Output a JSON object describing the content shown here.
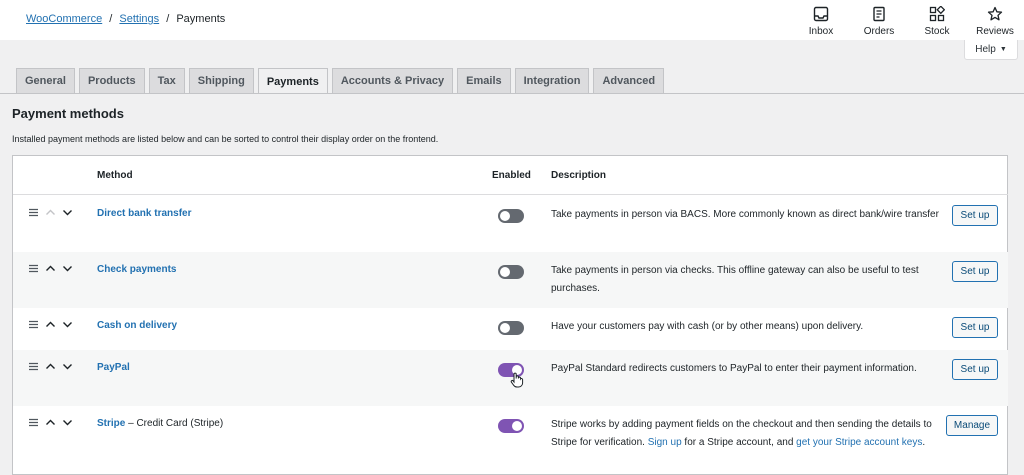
{
  "breadcrumb": {
    "root": "WooCommerce",
    "sep": "/",
    "middle": "Settings",
    "current": "Payments"
  },
  "toolbar": {
    "items": [
      {
        "label": "Inbox",
        "icon": "inbox-icon"
      },
      {
        "label": "Orders",
        "icon": "orders-icon"
      },
      {
        "label": "Stock",
        "icon": "stock-icon"
      },
      {
        "label": "Reviews",
        "icon": "star-icon"
      }
    ]
  },
  "help": {
    "label": "Help",
    "caret": "▼"
  },
  "tabs": [
    "General",
    "Products",
    "Tax",
    "Shipping",
    "Payments",
    "Accounts & Privacy",
    "Emails",
    "Integration",
    "Advanced"
  ],
  "active_tab": "Payments",
  "section": {
    "title": "Payment methods",
    "description": "Installed payment methods are listed below and can be sorted to control their display order on the frontend."
  },
  "table": {
    "headers": {
      "method": "Method",
      "enabled": "Enabled",
      "description": "Description"
    },
    "rows": [
      {
        "name": "Direct bank transfer",
        "suffix": "",
        "enabled": false,
        "description": "Take payments in person via BACS. More commonly known as direct bank/wire transfer",
        "desc_link1": "",
        "desc_mid": "",
        "desc_link2": "",
        "desc_end": "",
        "action": "Set up"
      },
      {
        "name": "Check payments",
        "suffix": "",
        "enabled": false,
        "description": "Take payments in person via checks. This offline gateway can also be useful to test purchases.",
        "desc_link1": "",
        "desc_mid": "",
        "desc_link2": "",
        "desc_end": "",
        "action": "Set up"
      },
      {
        "name": "Cash on delivery",
        "suffix": "",
        "enabled": false,
        "description": "Have your customers pay with cash (or by other means) upon delivery.",
        "desc_link1": "",
        "desc_mid": "",
        "desc_link2": "",
        "desc_end": "",
        "action": "Set up"
      },
      {
        "name": "PayPal",
        "suffix": "",
        "enabled": true,
        "description": "PayPal Standard redirects customers to PayPal to enter their payment information.",
        "desc_link1": "",
        "desc_mid": "",
        "desc_link2": "",
        "desc_end": "",
        "action": "Set up"
      },
      {
        "name": "Stripe",
        "suffix": " – Credit Card (Stripe)",
        "enabled": true,
        "description": "Stripe works by adding payment fields on the checkout and then sending the details to Stripe for verification. ",
        "desc_link1": "Sign up",
        "desc_mid": " for a Stripe account, and ",
        "desc_link2": "get your Stripe account keys",
        "desc_end": ".",
        "action": "Manage"
      }
    ]
  },
  "colors": {
    "accent": "#2271b1",
    "toggle_on": "#7f54b3",
    "toggle_off": "#646970"
  }
}
